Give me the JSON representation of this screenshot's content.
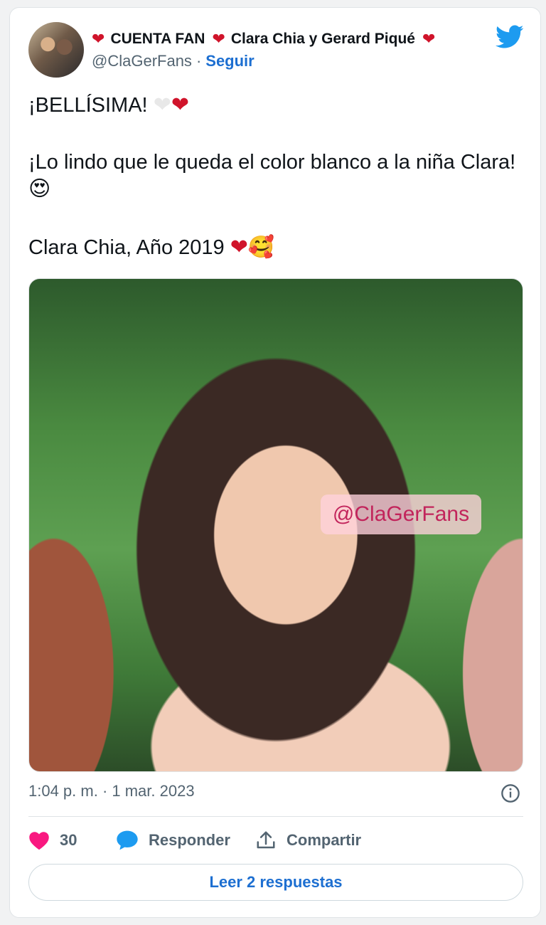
{
  "author": {
    "name_part1": "CUENTA FAN",
    "name_part2": "Clara Chia y Gerard Piqué",
    "handle": "@ClaGerFans",
    "separator": "·",
    "follow_label": "Seguir"
  },
  "tweet": {
    "line1_text": "¡BELLÍSIMA!",
    "line2_text": "¡Lo lindo que le queda el color blanco a la niña Clara!",
    "line3_text": "Clara Chia, Año 2019",
    "emoji": {
      "heart": "❤",
      "white_heart": "❤",
      "heart_eyes": "😍",
      "smiling_hearts": "🥰"
    }
  },
  "photo": {
    "watermark": "@ClaGerFans"
  },
  "meta": {
    "timestamp": "1:04 p. m. · 1 mar. 2023"
  },
  "actions": {
    "like_count": "30",
    "reply_label": "Responder",
    "share_label": "Compartir"
  },
  "read_replies_label": "Leer 2 respuestas",
  "colors": {
    "link_blue": "#1d6fd1",
    "heart_red": "#d0142b",
    "like_pink": "#f91880",
    "twitter_blue": "#1d9bf0",
    "secondary_text": "#536471"
  },
  "icons": {
    "bird": "twitter-bird-icon",
    "info": "info-icon",
    "like": "heart-icon",
    "reply": "speech-bubble-icon",
    "share": "share-upload-icon"
  }
}
